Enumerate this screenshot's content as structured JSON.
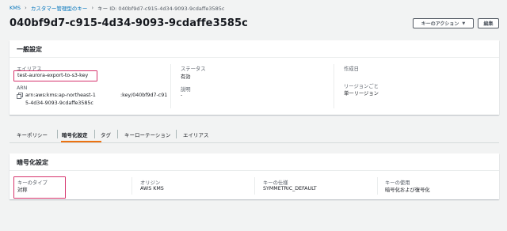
{
  "breadcrumb": {
    "items": [
      "KMS",
      "カスタマー管理型のキー",
      "キー ID: 040bf9d7-c915-4d34-9093-9cdaffe3585c"
    ]
  },
  "header": {
    "title": "040bf9d7-c915-4d34-9093-9cdaffe3585c",
    "actions_label": "キーのアクション",
    "edit_label": "編集"
  },
  "general": {
    "title": "一般設定",
    "alias_label": "エイリアス",
    "alias_value": "test-aurora-export-to-s3-key",
    "arn_label": "ARN",
    "arn_line1": "arn:aws:kms:ap-northeast-1",
    "arn_line1_tail": ":key/040bf9d7-c91",
    "arn_line2": "5-4d34-9093-9cdaffe3585c",
    "status_label": "ステータス",
    "status_value": "有効",
    "description_label": "説明",
    "description_value": "-",
    "created_label": "作成日",
    "created_value": "",
    "region_label": "リージョンごと",
    "region_value": "単一リージョン"
  },
  "tabs": [
    "キーポリシー",
    "暗号化設定",
    "タグ",
    "キーローテーション",
    "エイリアス"
  ],
  "active_tab": "暗号化設定",
  "encryption": {
    "title": "暗号化設定",
    "key_type_label": "キーのタイプ",
    "key_type_value": "対称",
    "origin_label": "オリジン",
    "origin_value": "AWS KMS",
    "spec_label": "キーの仕様",
    "spec_value": "SYMMETRIC_DEFAULT",
    "usage_label": "キーの使用",
    "usage_value": "暗号化および復号化"
  },
  "colors": {
    "link": "#0073bb",
    "highlight": "#d6336c",
    "tab_active": "#ec7211",
    "background": "#f2f3f3"
  }
}
